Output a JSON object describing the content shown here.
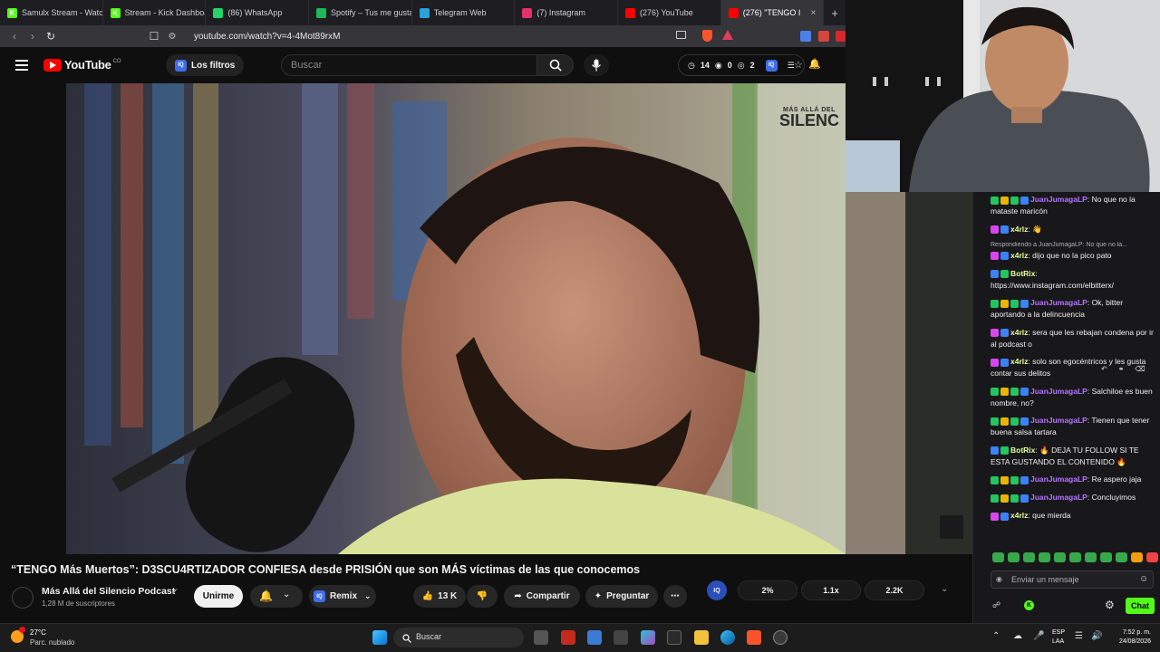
{
  "browser": {
    "tabs": [
      {
        "label": "Samulx Stream - Watch",
        "icon_color": "#53fc18",
        "icon_glyph": "K"
      },
      {
        "label": "Stream - Kick Dashboa",
        "icon_color": "#53fc18",
        "icon_glyph": "K"
      },
      {
        "label": "(86) WhatsApp",
        "icon_color": "#25d366",
        "icon_glyph": ""
      },
      {
        "label": "Spotify – Tus me gusta",
        "icon_color": "#1db954",
        "icon_glyph": ""
      },
      {
        "label": "Telegram Web",
        "icon_color": "#2aa1da",
        "icon_glyph": ""
      },
      {
        "label": "(7) Instagram",
        "icon_color": "#e1306c",
        "icon_glyph": ""
      },
      {
        "label": "(276) YouTube",
        "icon_color": "#ff0000",
        "icon_glyph": ""
      },
      {
        "label": "(276) \"TENGO I",
        "icon_color": "#ff0000",
        "icon_glyph": "",
        "active": true
      }
    ],
    "url": "youtube.com/watch?v=4-4Mot89rxM"
  },
  "youtube": {
    "logo_text": "YouTube",
    "logo_country": "CO",
    "filter_label": "Los filtros",
    "search_placeholder": "Buscar",
    "header_stats": {
      "a": "14",
      "b": "0",
      "c": "2"
    },
    "watermark_line1": "MÁS ALLÁ DEL",
    "watermark_line2": "SILENC",
    "video_title": "“TENGO Más Muertos”: D3SCU4RTIZADOR CONFIESA desde PRISIÓN que son MÁS víctimas de las que conocemos",
    "channel_name": "Más Allá del Silencio Podcast",
    "subscribers": "1,28 M de suscriptores",
    "join_label": "Unirme",
    "remix_label": "Remix",
    "likes": "13 K",
    "share_label": "Compartir",
    "ask_label": "Preguntar",
    "ext_badge": "IQ",
    "ext_stats": [
      "2%",
      "1.1x",
      "2.2K"
    ]
  },
  "chat": {
    "messages": [
      {
        "user": "JuanJumagaLP",
        "color": "#b574ff",
        "badges": [
          "#22c55e",
          "#eab308",
          "#22c55e",
          "#3b82f6"
        ],
        "text": "No que no la mataste maricón"
      },
      {
        "user": "x4rlz",
        "color": "#e7ff9a",
        "badges": [
          "#d946ef",
          "#3b82f6"
        ],
        "text": "👋"
      },
      {
        "reply": "Respondiendo a JuanJumagaLP: No que no la...",
        "user": "x4rlz",
        "color": "#e7ff9a",
        "badges": [
          "#d946ef",
          "#3b82f6"
        ],
        "text": "dijo que no la pico pato"
      },
      {
        "user": "BotRix",
        "color": "#e7ff9a",
        "badges": [
          "#3b82f6",
          "#22c55e"
        ],
        "text": "https://www.instagram.com/elbitterx/"
      },
      {
        "user": "JuanJumagaLP",
        "color": "#b574ff",
        "badges": [
          "#22c55e",
          "#eab308",
          "#22c55e",
          "#3b82f6"
        ],
        "text": "Ok, bitter aportando a la delincuencia"
      },
      {
        "user": "x4rlz",
        "color": "#e7ff9a",
        "badges": [
          "#d946ef",
          "#3b82f6"
        ],
        "text": "sera que les rebajan condena por ir al podcast o"
      },
      {
        "user": "x4rlz",
        "color": "#e7ff9a",
        "badges": [
          "#d946ef",
          "#3b82f6"
        ],
        "text": "solo son egocéntricos y les gusta contar sus delitos"
      },
      {
        "user": "JuanJumagaLP",
        "color": "#b574ff",
        "badges": [
          "#22c55e",
          "#eab308",
          "#22c55e",
          "#3b82f6"
        ],
        "text": "Salchiloe es buen nombre, no?"
      },
      {
        "user": "JuanJumagaLP",
        "color": "#b574ff",
        "badges": [
          "#22c55e",
          "#eab308",
          "#22c55e",
          "#3b82f6"
        ],
        "text": "Tienen que tener buena salsa tartara"
      },
      {
        "user": "BotRix",
        "color": "#e7ff9a",
        "badges": [
          "#3b82f6",
          "#22c55e"
        ],
        "text": "🔥 DEJA TU FOLLOW SI TE ESTA GUSTANDO EL CONTENIDO 🔥"
      },
      {
        "user": "JuanJumagaLP",
        "color": "#b574ff",
        "badges": [
          "#22c55e",
          "#eab308",
          "#22c55e",
          "#3b82f6"
        ],
        "text": "Re aspero jaja"
      },
      {
        "user": "JuanJumagaLP",
        "color": "#b574ff",
        "badges": [
          "#22c55e",
          "#eab308",
          "#22c55e",
          "#3b82f6"
        ],
        "text": "Concluyimos"
      },
      {
        "user": "x4rlz",
        "color": "#e7ff9a",
        "badges": [
          "#d946ef",
          "#3b82f6"
        ],
        "text": "que mierda"
      }
    ],
    "input_placeholder": "Enviar un mensaje",
    "send_label": "Chat",
    "accent": "#53fc18"
  },
  "taskbar": {
    "temperature": "27°C",
    "weather": "Parc. nublado",
    "search_label": "Buscar",
    "lang1": "ESP",
    "lang2": "LAA",
    "time": "7:52 p. m.",
    "date": "24/08/2026"
  }
}
